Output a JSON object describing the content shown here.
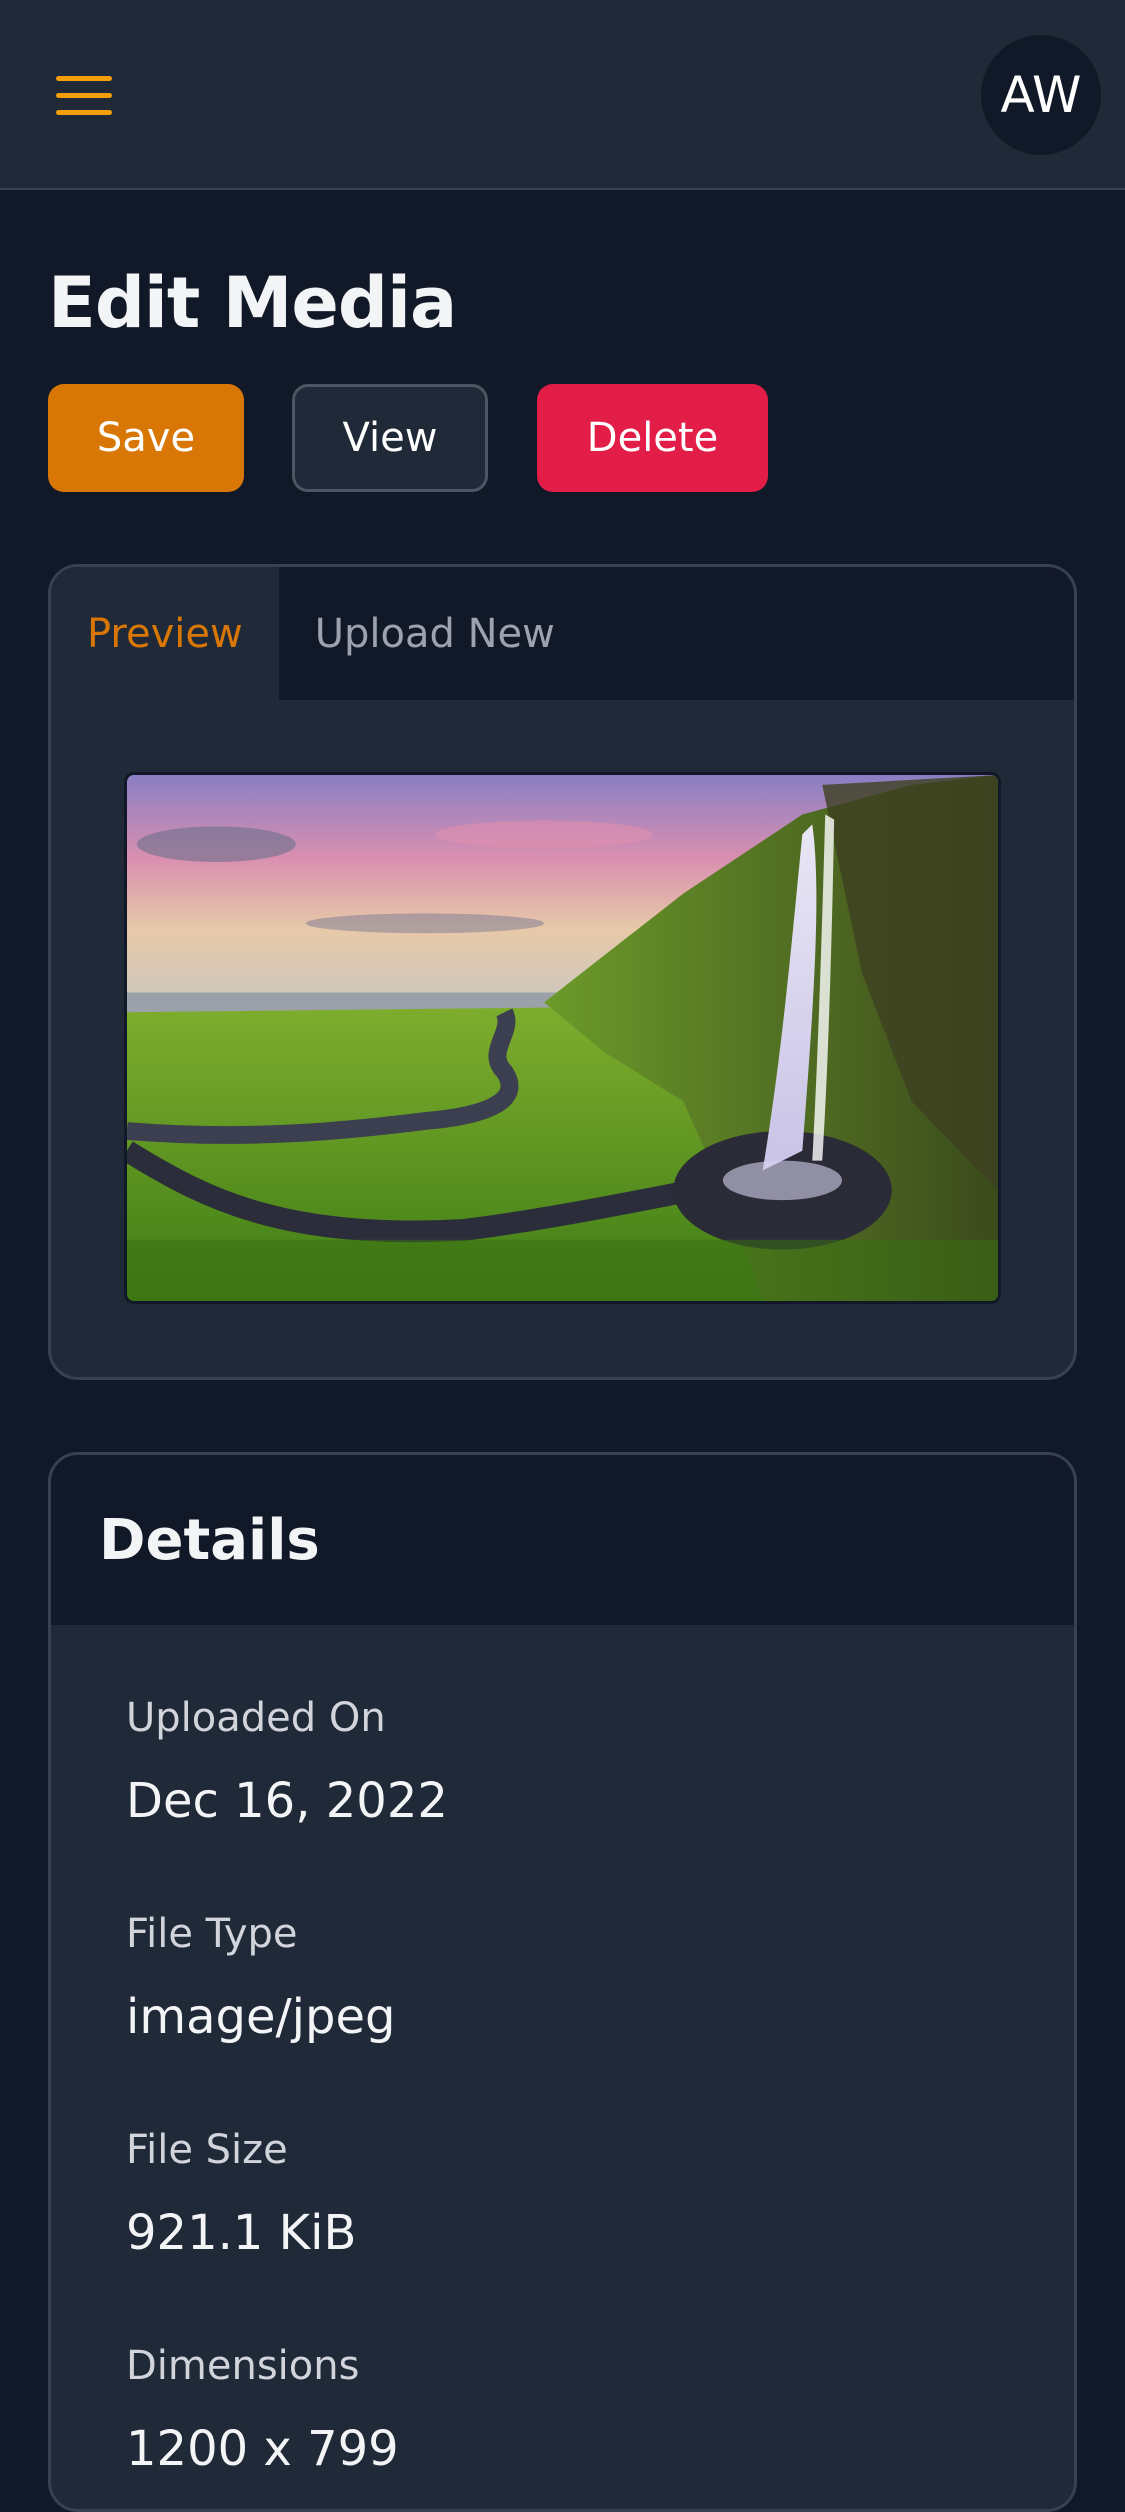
{
  "header": {
    "avatar_initials": "AW",
    "menu_icon": "hamburger-menu-icon"
  },
  "page": {
    "title": "Edit Media"
  },
  "actions": {
    "save_label": "Save",
    "view_label": "View",
    "delete_label": "Delete"
  },
  "preview": {
    "tabs": [
      {
        "label": "Preview",
        "active": true
      },
      {
        "label": "Upload New",
        "active": false
      }
    ]
  },
  "details": {
    "title": "Details",
    "fields": [
      {
        "label": "Uploaded On",
        "value": "Dec 16, 2022"
      },
      {
        "label": "File Type",
        "value": "image/jpeg"
      },
      {
        "label": "File Size",
        "value": "921.1 KiB"
      },
      {
        "label": "Dimensions",
        "value": "1200 x 799"
      }
    ]
  },
  "colors": {
    "background": "#111827",
    "surface": "#1f2937",
    "accent": "#d97706",
    "danger": "#e11d48"
  }
}
